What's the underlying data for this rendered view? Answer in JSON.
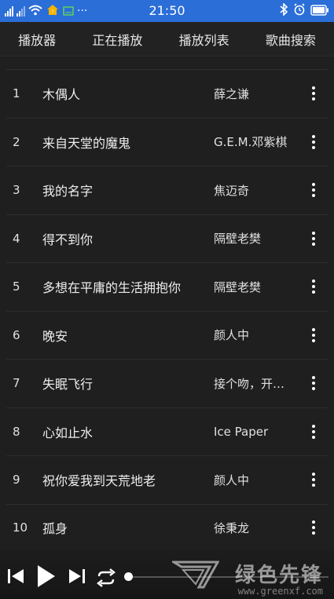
{
  "status_bar": {
    "time": "21:50",
    "icons": [
      "signal-icon",
      "wifi-icon",
      "home-icon",
      "message-icon",
      "more-dots-icon",
      "bluetooth-icon",
      "alarm-icon",
      "battery-icon"
    ],
    "notification_dots": "···"
  },
  "tabs": [
    {
      "label": "播放器"
    },
    {
      "label": "正在播放"
    },
    {
      "label": "播放列表"
    },
    {
      "label": "歌曲搜索"
    }
  ],
  "songs": [
    {
      "index": "1",
      "title": "木偶人",
      "artist": "薛之谦"
    },
    {
      "index": "2",
      "title": "来自天堂的魔鬼",
      "artist": "G.E.M.邓紫棋"
    },
    {
      "index": "3",
      "title": "我的名字",
      "artist": "焦迈奇"
    },
    {
      "index": "4",
      "title": "得不到你",
      "artist": "隔壁老樊"
    },
    {
      "index": "5",
      "title": "多想在平庸的生活拥抱你",
      "artist": "隔壁老樊"
    },
    {
      "index": "6",
      "title": "晚安",
      "artist": "颜人中"
    },
    {
      "index": "7",
      "title": "失眠飞行",
      "artist": "接个吻，开…"
    },
    {
      "index": "8",
      "title": "心如止水",
      "artist": "Ice Paper"
    },
    {
      "index": "9",
      "title": "祝你爱我到天荒地老",
      "artist": "颜人中"
    },
    {
      "index": "10",
      "title": "孤身",
      "artist": "徐秉龙"
    }
  ],
  "player": {
    "progress": 0.0,
    "controls": [
      "previous-icon",
      "play-icon",
      "next-icon",
      "repeat-icon"
    ]
  },
  "watermark": {
    "brand": "绿色先锋",
    "url": "www.greenxf.com"
  },
  "colors": {
    "status_bar": "#2b6ed8",
    "background": "#1f1f1f",
    "text": "#eaeaea"
  }
}
